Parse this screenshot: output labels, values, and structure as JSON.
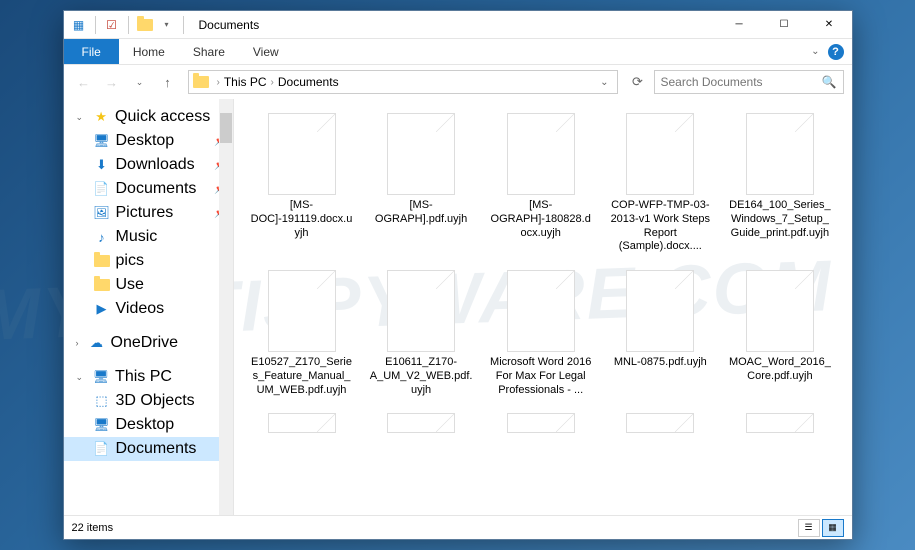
{
  "window": {
    "title": "Documents"
  },
  "ribbon": {
    "file": "File",
    "tabs": [
      "Home",
      "Share",
      "View"
    ]
  },
  "breadcrumb": {
    "segments": [
      "This PC",
      "Documents"
    ]
  },
  "search": {
    "placeholder": "Search Documents"
  },
  "sidebar": {
    "quick_access": {
      "label": "Quick access",
      "items": [
        {
          "label": "Desktop",
          "icon": "desktop",
          "pinned": true
        },
        {
          "label": "Downloads",
          "icon": "downloads",
          "pinned": true
        },
        {
          "label": "Documents",
          "icon": "documents",
          "pinned": true
        },
        {
          "label": "Pictures",
          "icon": "pictures",
          "pinned": true
        },
        {
          "label": "Music",
          "icon": "music",
          "pinned": false
        },
        {
          "label": "pics",
          "icon": "folder",
          "pinned": false
        },
        {
          "label": "Use",
          "icon": "folder",
          "pinned": false
        },
        {
          "label": "Videos",
          "icon": "videos",
          "pinned": false
        }
      ]
    },
    "onedrive": {
      "label": "OneDrive"
    },
    "this_pc": {
      "label": "This PC",
      "items": [
        {
          "label": "3D Objects",
          "icon": "3d"
        },
        {
          "label": "Desktop",
          "icon": "desktop"
        },
        {
          "label": "Documents",
          "icon": "documents",
          "selected": true
        }
      ]
    }
  },
  "files": [
    {
      "name": "[MS-DOC]-191119.docx.uyjh"
    },
    {
      "name": "[MS-OGRAPH].pdf.uyjh"
    },
    {
      "name": "[MS-OGRAPH]-180828.docx.uyjh"
    },
    {
      "name": "COP-WFP-TMP-03-2013-v1 Work Steps Report (Sample).docx...."
    },
    {
      "name": "DE164_100_Series_Windows_7_Setup_Guide_print.pdf.uyjh"
    },
    {
      "name": "E10527_Z170_Series_Feature_Manual_UM_WEB.pdf.uyjh"
    },
    {
      "name": "E10611_Z170-A_UM_V2_WEB.pdf.uyjh"
    },
    {
      "name": "Microsoft Word 2016 For Max For Legal Professionals - ..."
    },
    {
      "name": "MNL-0875.pdf.uyjh"
    },
    {
      "name": "MOAC_Word_2016_Core.pdf.uyjh"
    }
  ],
  "status": {
    "item_count": "22 items"
  },
  "watermark": "MYANTISPYWARE.COM"
}
